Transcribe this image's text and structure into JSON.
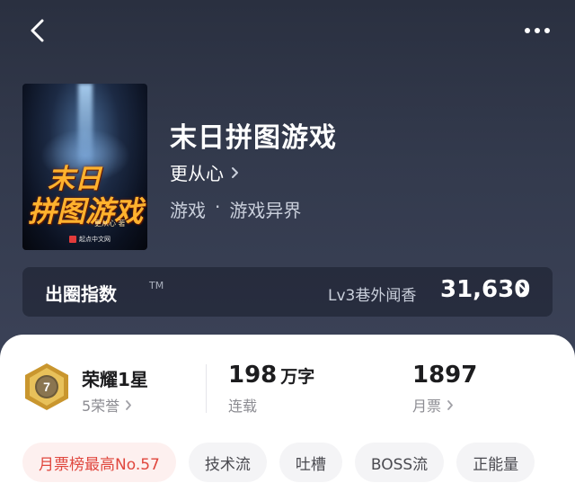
{
  "header": {
    "back_icon": "chevron-left-icon",
    "more_icon": "more-horizontal-icon"
  },
  "book": {
    "cover_title_line1": "末日",
    "cover_title_line2": "拼图游戏",
    "cover_author": "更从心 著",
    "cover_publisher": "起点中文网",
    "title": "末日拼图游戏",
    "author": "更从心",
    "category": "游戏",
    "subcategory": "游戏异界",
    "separator": "·"
  },
  "index": {
    "label": "出圈指数",
    "tm": "TM",
    "level": "Lv3巷外闻香",
    "value": "31,630"
  },
  "stats": {
    "honor_title": "荣耀1星",
    "honor_sub": "5荣誉",
    "badge_number": "7",
    "words_num": "198",
    "words_unit": "万字",
    "status": "连载",
    "votes": "1897",
    "votes_label": "月票"
  },
  "tags": [
    {
      "label": "月票榜最高No.57",
      "hot": true
    },
    {
      "label": "技术流"
    },
    {
      "label": "吐槽"
    },
    {
      "label": "BOSS流"
    },
    {
      "label": "正能量"
    }
  ],
  "colors": {
    "hero_bg": "#333a4d",
    "accent_red": "#e0473e",
    "badge_gold": "#c9962e"
  }
}
